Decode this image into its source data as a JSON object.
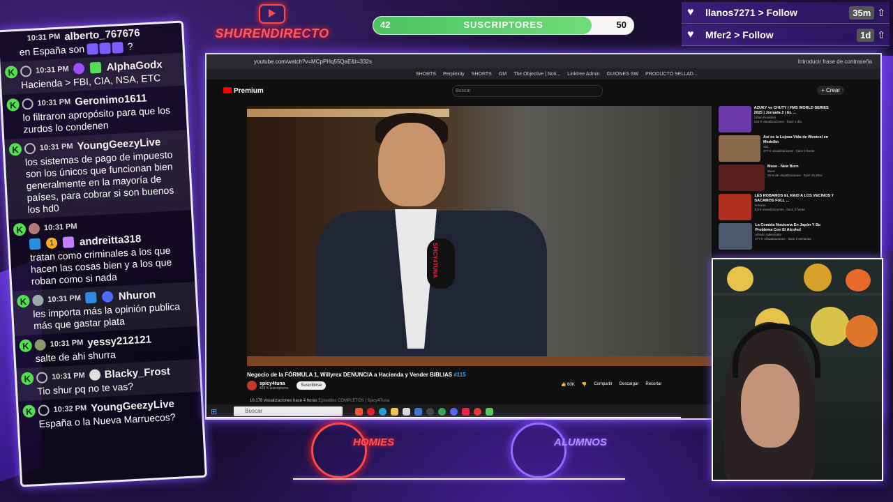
{
  "brand": {
    "name": "SHURENDIRECTO"
  },
  "subs_goal": {
    "current": "42",
    "label": "SUSCRIPTORES",
    "goal": "50",
    "progress": 0.84
  },
  "follows": [
    {
      "name": "llanos7271 > Follow",
      "ago": "35m"
    },
    {
      "name": "Mfer2 > Follow",
      "ago": "1d"
    }
  ],
  "chat": [
    {
      "time": "10:31 PM",
      "user": "alberto_767676",
      "text": "en España son ",
      "suffix": "?"
    },
    {
      "time": "10:31 PM",
      "user": "AlphaGodx",
      "text": "Hacienda > FBI, CIA, NSA, ETC"
    },
    {
      "time": "10:31 PM",
      "user": "Geronimo1611",
      "text": "lo filtraron apropósito para que los zurdos lo condenen"
    },
    {
      "time": "10:31 PM",
      "user": "YoungGeezyLive",
      "text": "los sistemas de pago de impuesto son los únicos que funcionan bien generalmente en la mayoría de países, para cobrar si son buenos los hd0"
    },
    {
      "time": "10:31 PM",
      "user": "andreitta318",
      "badge_number": "1",
      "text": "tratan como criminales a los que hacen las cosas bien y a los que roban como si nada"
    },
    {
      "time": "10:31 PM",
      "user": "Nhuron",
      "text": "les importa más la opinión publica más que gastar plata"
    },
    {
      "time": "10:31 PM",
      "user": "yessy212121",
      "text": "salte de ahi shurra"
    },
    {
      "time": "10:31 PM",
      "user": "Blacky_Frost",
      "text": "Tio shur pq no te vas?"
    },
    {
      "time": "10:32 PM",
      "user": "YoungGeezyLive",
      "text": "España o la Nueva Marruecos?"
    }
  ],
  "browser": {
    "url": "youtube.com/watch?v=MCpPHq55QaE&t=332s",
    "password_btn": "Introducir frase de contraseña",
    "bookmarks": [
      "SHORTS",
      "Perplexity",
      "SHORTS",
      "GM",
      "The Objective | Noti...",
      "Linktree Admin",
      "GUIONES SW",
      "PRODUCTO SELLAD..."
    ],
    "yt_brand": "Premium",
    "search_placeholder": "Buscar",
    "create": "+ Crear"
  },
  "video": {
    "title": "Negocio de la FÓRMULA 1, Willyrex DENUNCIA a Hacienda y Vender BIBLIAS",
    "tag": "#115",
    "channel": "spicy4tuna",
    "channel_subs": "429 K suscriptores",
    "subscribe": "Suscribirse",
    "mic_label": "SPICY4TUNA",
    "likes": "60K",
    "share": "Compartir",
    "download": "Descargar",
    "clip": "Recortar",
    "views": "10.178 visualizaciones  hace 4 horas",
    "playlist": "Episodios COMPLETOS | Spicy4Tuna"
  },
  "related": [
    {
      "title": "AZUKY vs CHUTY | FMS WORLD SERIES 2025 | Jornada 2 | EL ...",
      "channel": "Urban Roosters",
      "meta": "103 K visualizaciones · hace 1 día",
      "color": "#6a3aa8"
    },
    {
      "title": "Así es la Lujosa Vida de Westcol en Medellín",
      "channel": "Sisi",
      "meta": "277 K visualizaciones · hace 2 horas",
      "color": "#8a6a4a"
    },
    {
      "title": "Muse - New Born",
      "channel": "Muse",
      "meta": "39 M de visualizaciones · hace 15 años",
      "color": "#5a2020"
    },
    {
      "title": "LES ROBAMOS EL RAID A LOS VECINOS Y SACAMOS FULL ...",
      "channel": "Volcano",
      "meta": "8,5 K visualizaciones · hace 3 horas",
      "color": "#b03020"
    },
    {
      "title": "La Comida Nocturna En Japón Y Su Problema Con El Alcohol",
      "channel": "Alfredo Valenzuela",
      "meta": "277 K visualizaciones · hace 2 semanas",
      "color": "#4a5a6a"
    }
  ],
  "taskbar": {
    "search": "Buscar"
  },
  "bottom": {
    "left_label": "HOMIES",
    "right_label": "ALUMNOS"
  },
  "colors": {
    "accent": "#7a4cff",
    "brand_red": "#ff4a4a",
    "progress_green": "#4ec35f"
  }
}
